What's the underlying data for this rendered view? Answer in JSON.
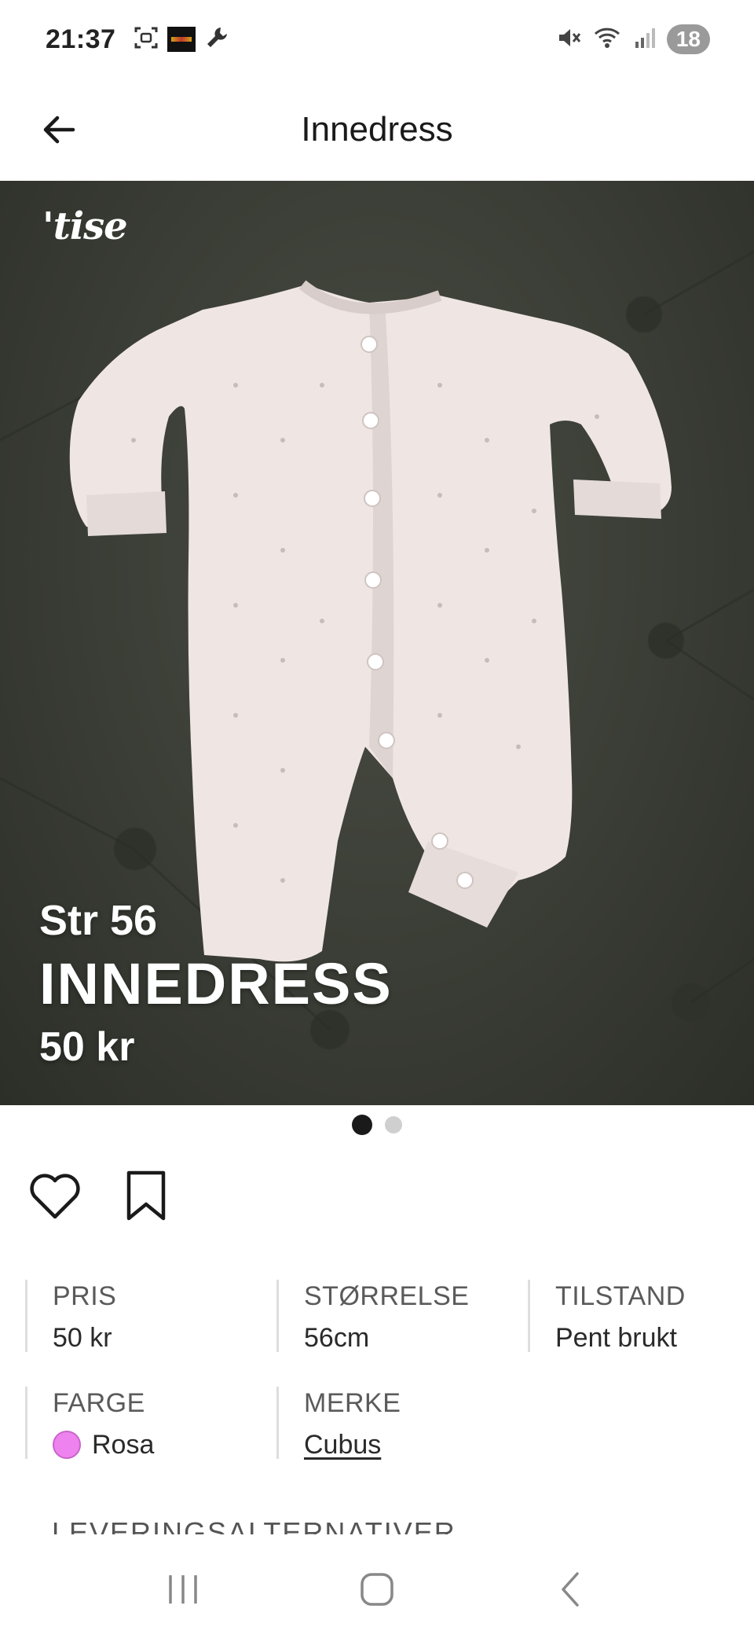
{
  "status_bar": {
    "time": "21:37",
    "battery": "18",
    "icons": [
      "screenshot-icon",
      "app-notification-icon",
      "wrench-icon",
      "mute-icon",
      "wifi-icon",
      "signal-icon"
    ]
  },
  "app_bar": {
    "title": "Innedress",
    "back_icon": "arrow-left-icon"
  },
  "hero": {
    "logo": "'tise",
    "size_text": "Str 56",
    "name_text": "INNEDRESS",
    "price_text": "50 kr",
    "image_count": 2,
    "current_image": 1
  },
  "actions": {
    "like_icon": "heart-icon",
    "save_icon": "bookmark-icon"
  },
  "details": {
    "price": {
      "label": "PRIS",
      "value": "50 kr"
    },
    "size": {
      "label": "STØRRELSE",
      "value": "56cm"
    },
    "condition": {
      "label": "TILSTAND",
      "value": "Pent brukt"
    },
    "color": {
      "label": "FARGE",
      "value": "Rosa",
      "swatch": "#ee82ee"
    },
    "brand": {
      "label": "MERKE",
      "value": "Cubus"
    }
  },
  "next_section": {
    "label": "LEVERINGSALTERNATIVER"
  },
  "nav_bar": {
    "recent_icon": "recent-apps-icon",
    "home_icon": "home-icon",
    "back_icon": "nav-back-icon"
  }
}
